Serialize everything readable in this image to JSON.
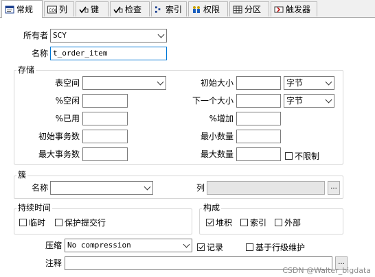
{
  "tabs": [
    {
      "label": "常规",
      "icon": "general-icon",
      "active": true
    },
    {
      "label": "列",
      "icon": "columns-icon"
    },
    {
      "label": "键",
      "icon": "key-icon"
    },
    {
      "label": "检查",
      "icon": "check-icon"
    },
    {
      "label": "索引",
      "icon": "index-icon"
    },
    {
      "label": "权限",
      "icon": "users-icon"
    },
    {
      "label": "分区",
      "icon": "grid-icon"
    },
    {
      "label": "触发器",
      "icon": "trigger-icon"
    }
  ],
  "general": {
    "owner_label": "所有者",
    "owner_value": "SCY",
    "name_label": "名称",
    "name_value": "t_order_item"
  },
  "storage": {
    "title": "存储",
    "tablespace_label": "表空间",
    "pct_free_label": "%空闲",
    "pct_used_label": "%已用",
    "ini_trans_label": "初始事务数",
    "max_trans_label": "最大事务数",
    "initial_label": "初始大小",
    "initial_unit": "字节",
    "next_label": "下一个大小",
    "next_unit": "字节",
    "pct_increase_label": "%增加",
    "min_extents_label": "最小数量",
    "max_extents_label": "最大数量",
    "unlimited_label": "不限制"
  },
  "cluster": {
    "title": "簇",
    "name_label": "名称",
    "columns_label": "列",
    "browse_label": "..."
  },
  "duration": {
    "title": "持续时间",
    "temporary_label": "临时",
    "preserve_label": "保护提交行"
  },
  "organization": {
    "title": "构成",
    "heap_label": "堆积",
    "index_label": "索引",
    "external_label": "外部"
  },
  "compression": {
    "label": "压缩",
    "value": "No compression"
  },
  "logging_label": "记录",
  "row_movement_label": "基于行级维护",
  "comment_label": "注释",
  "watermark": "CSDN @Walter_bigdata"
}
